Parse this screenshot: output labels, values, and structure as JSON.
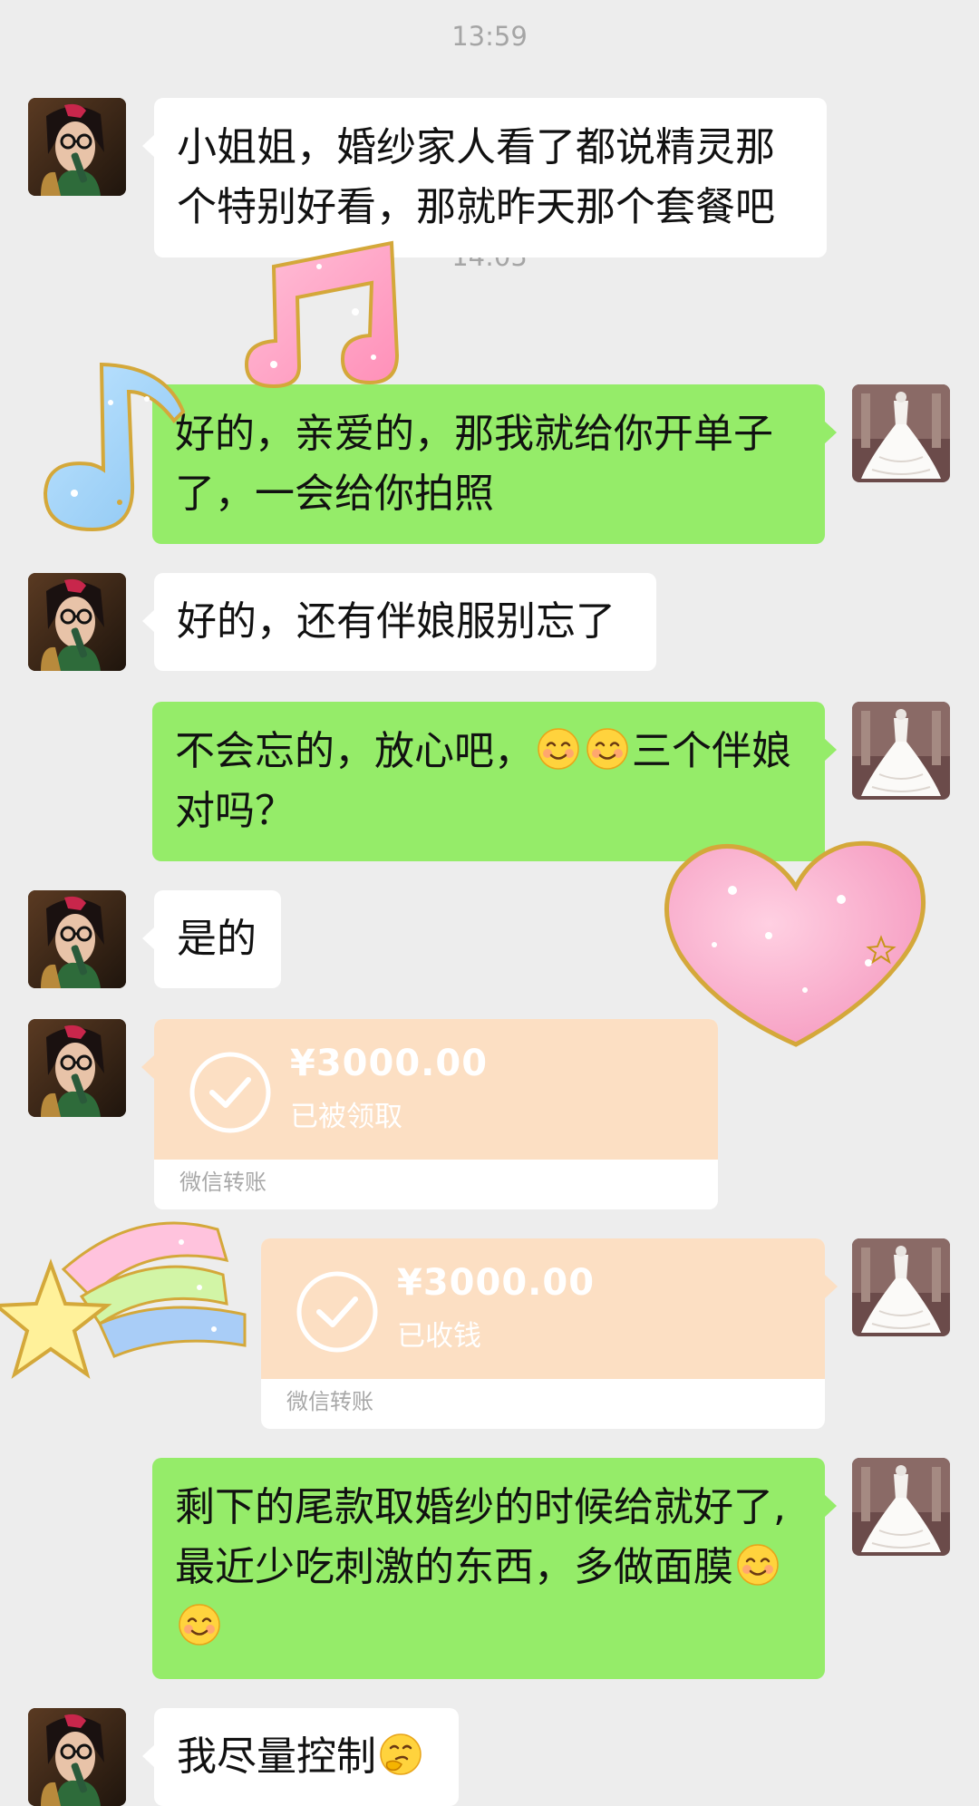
{
  "timestamps": [
    "13:59",
    "14:05"
  ],
  "messages": [
    {
      "side": "left",
      "lines": [
        "小姐姐，婚纱家人看了都说精灵那",
        "个特别好看，那就昨天那个套餐吧"
      ]
    },
    {
      "side": "right",
      "lines": [
        "好的，亲爱的，那我就给你开单子",
        "了，一会给你拍照"
      ]
    },
    {
      "side": "left",
      "lines": [
        "好的，还有伴娘服别忘了"
      ]
    },
    {
      "side": "right",
      "line1_pre": "不会忘的，放心吧，",
      "line1_post": "三个伴娘",
      "line2": "对吗？",
      "emoji": "smiling-face"
    },
    {
      "side": "left",
      "lines": [
        "是的"
      ]
    },
    {
      "side": "right",
      "line1": "剩下的尾款取婚纱的时候给就好了,",
      "line2_pre": "最近少吃刺激的东西，多做面膜",
      "emoji": "smiling-face"
    },
    {
      "side": "left",
      "line1_pre": "我尽量控制",
      "emoji": "thinking-face"
    }
  ],
  "transfers": [
    {
      "side": "left",
      "amount": "¥3000.00",
      "status": "已被领取",
      "label": "微信转账"
    },
    {
      "side": "right",
      "amount": "¥3000.00",
      "status": "已收钱",
      "label": "微信转账"
    }
  ],
  "colors": {
    "background": "#ededed",
    "bubble_self": "#95ec69",
    "bubble_other": "#ffffff",
    "transfer": "#fcdfc3"
  },
  "stickers": [
    "music-note-pink",
    "music-note-blue",
    "glitter-heart-pink",
    "shooting-star-rainbow"
  ]
}
